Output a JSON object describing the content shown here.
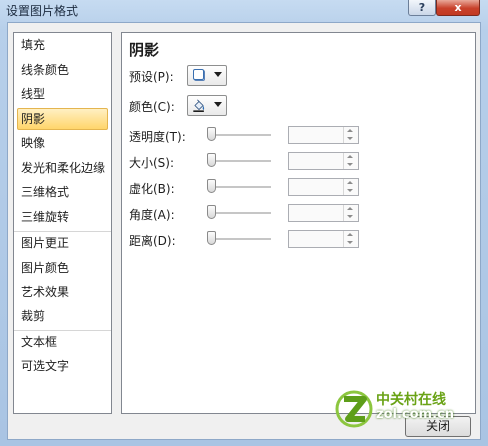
{
  "window": {
    "title": "设置图片格式",
    "help_glyph": "?",
    "close_glyph": "x"
  },
  "nav": {
    "items": [
      {
        "label": "填充",
        "selected": false
      },
      {
        "label": "线条颜色",
        "selected": false
      },
      {
        "label": "线型",
        "selected": false
      },
      {
        "label": "阴影",
        "selected": true
      },
      {
        "label": "映像",
        "selected": false
      },
      {
        "label": "发光和柔化边缘",
        "selected": false
      },
      {
        "label": "三维格式",
        "selected": false
      },
      {
        "label": "三维旋转",
        "selected": false
      },
      {
        "label": "图片更正",
        "selected": false
      },
      {
        "label": "图片颜色",
        "selected": false
      },
      {
        "label": "艺术效果",
        "selected": false
      },
      {
        "label": "裁剪",
        "selected": false
      },
      {
        "label": "文本框",
        "selected": false
      },
      {
        "label": "可选文字",
        "selected": false
      }
    ]
  },
  "panel": {
    "title": "阴影",
    "preset_label": "预设(P):",
    "color_label": "颜色(C):",
    "fields": [
      {
        "label": "透明度(T):",
        "value": "",
        "slider_fraction": 0
      },
      {
        "label": "大小(S):",
        "value": "",
        "slider_fraction": 0
      },
      {
        "label": "虚化(B):",
        "value": "",
        "slider_fraction": 0
      },
      {
        "label": "角度(A):",
        "value": "",
        "slider_fraction": 0
      },
      {
        "label": "距离(D):",
        "value": "",
        "slider_fraction": 0
      }
    ]
  },
  "footer": {
    "close_label": "关闭"
  },
  "watermark": {
    "name": "中关村在线",
    "domain": "zol.com.cn"
  },
  "icons": {
    "preset": "shadow-preset-icon",
    "color": "paint-bucket-icon",
    "dropdown": "dropdown-arrow-icon",
    "logo": "zol-logo-icon"
  },
  "colors": {
    "selected_item": "#ffd56b",
    "close_button": "#c8412b",
    "watermark": "#6aa316"
  }
}
